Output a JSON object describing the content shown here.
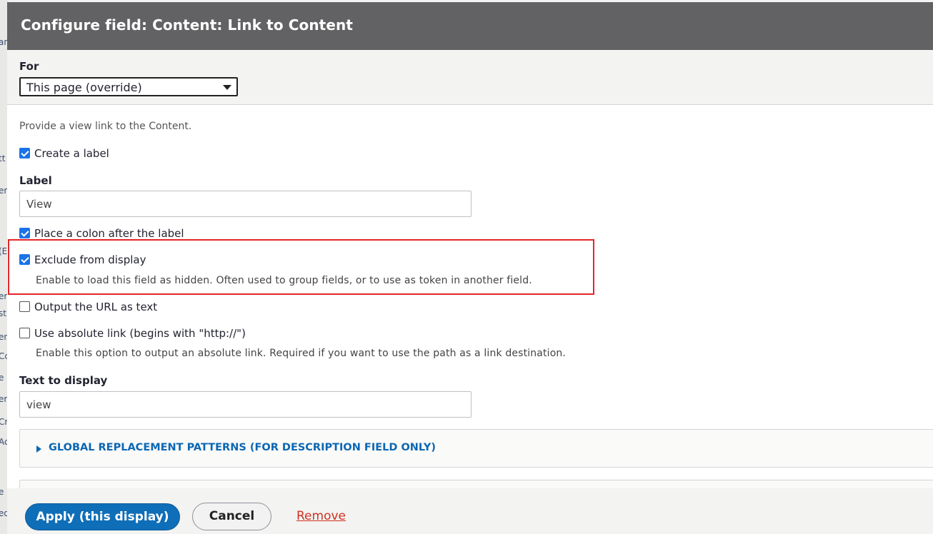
{
  "dialog": {
    "title": "Configure field: Content: Link to Content"
  },
  "for_section": {
    "label": "For",
    "selected": "This page (override)"
  },
  "form": {
    "description": "Provide a view link to the Content.",
    "create_label": {
      "label": "Create a label",
      "checked": true
    },
    "label_field": {
      "label": "Label",
      "value": "View"
    },
    "place_colon": {
      "label": "Place a colon after the label",
      "checked": true
    },
    "exclude": {
      "label": "Exclude from display",
      "checked": true,
      "help": "Enable to load this field as hidden. Often used to group fields, or to use as token in another field."
    },
    "output_url": {
      "label": "Output the URL as text",
      "checked": false
    },
    "absolute_link": {
      "label": "Use absolute link (begins with \"http://\")",
      "checked": false,
      "help": "Enable this option to output an absolute link. Required if you want to use the path as a link destination."
    },
    "text_to_display": {
      "label": "Text to display",
      "value": "view"
    },
    "replacement_patterns": "GLOBAL REPLACEMENT PATTERNS (FOR DESCRIPTION FIELD ONLY)"
  },
  "footer": {
    "apply": "Apply (this display)",
    "cancel": "Cancel",
    "remove": "Remove"
  },
  "colors": {
    "titlebar": "#626264",
    "primary_button": "#0f6eb8",
    "link": "#0b67b3",
    "remove_link": "#d1301f",
    "highlight": "#e4262a"
  }
}
